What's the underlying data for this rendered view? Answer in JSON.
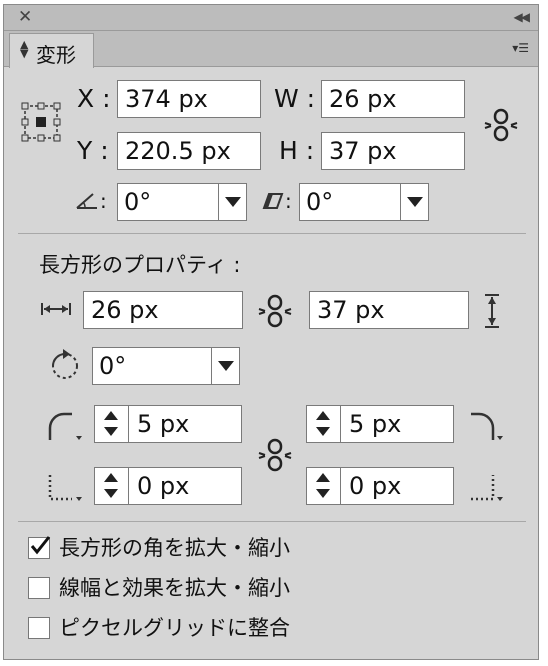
{
  "panel": {
    "tab_label": "変形"
  },
  "transform": {
    "x_label": "X :",
    "y_label": "Y :",
    "w_label": "W :",
    "h_label": "H :",
    "x_value": "374 px",
    "y_value": "220.5 px",
    "w_value": "26 px",
    "h_value": "37 px",
    "angle_label": ":",
    "angle_value": "0°",
    "shear_label": ":",
    "shear_value": "0°"
  },
  "rect_props": {
    "title": "長方形のプロパティ :",
    "width_value": "26 px",
    "height_value": "37 px",
    "rotation_value": "0°",
    "corner_tl_value": "5 px",
    "corner_tr_value": "5 px",
    "corner_bl_value": "0 px",
    "corner_br_value": "0 px"
  },
  "options": [
    {
      "label": "長方形の角を拡大・縮小",
      "checked": true
    },
    {
      "label": "線幅と効果を拡大・縮小",
      "checked": false
    },
    {
      "label": "ピクセルグリッドに整合",
      "checked": false
    }
  ]
}
